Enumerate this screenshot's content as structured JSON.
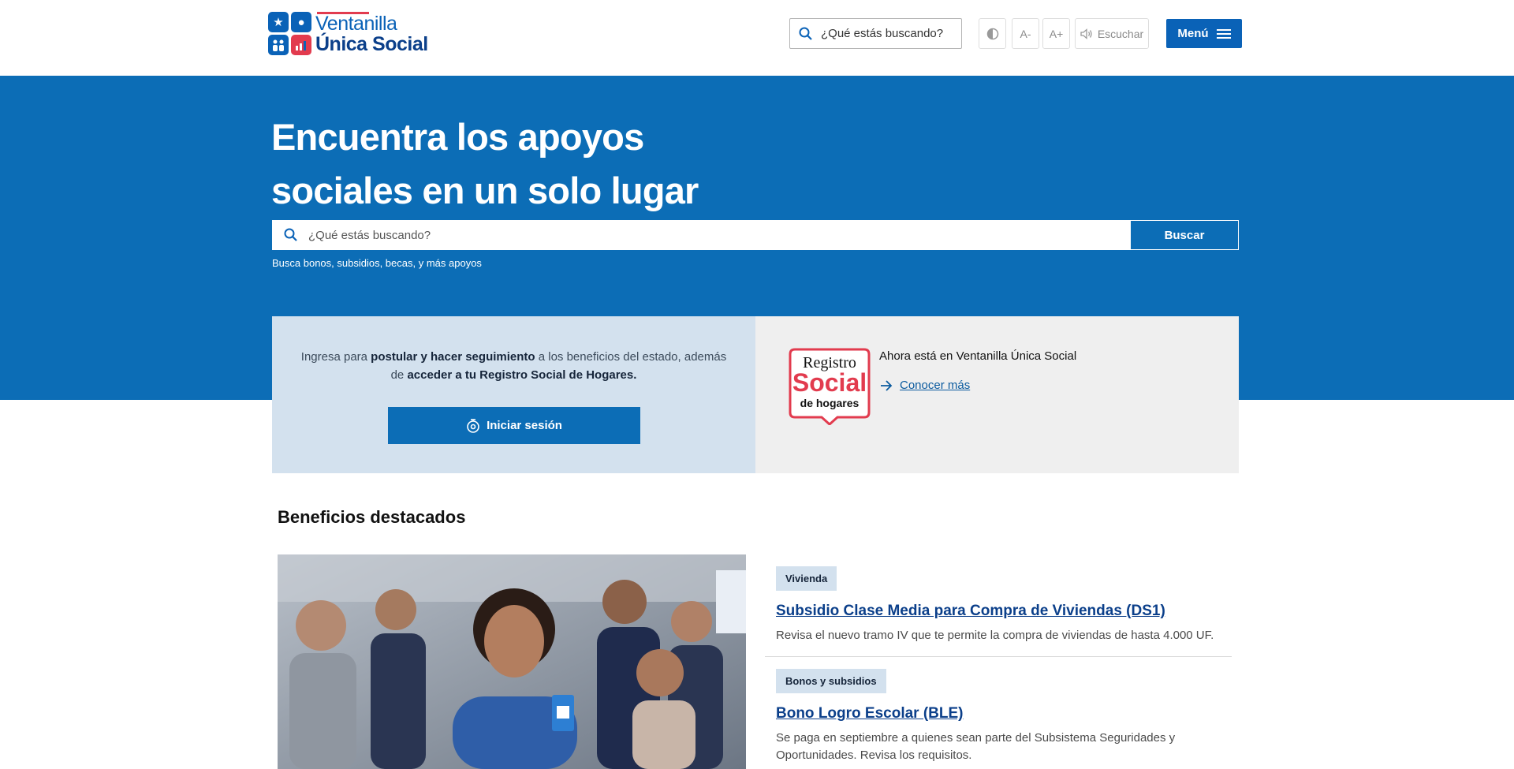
{
  "header": {
    "logo_line1": "Ventanilla",
    "logo_line2": "Única Social",
    "search_placeholder": "¿Qué estás buscando?",
    "contrast_icon": "contrast-icon",
    "font_decrease": "A-",
    "font_increase": "A+",
    "listen_label": "Escuchar",
    "menu_label": "Menú"
  },
  "hero": {
    "title_line1": "Encuentra los apoyos",
    "title_line2": "sociales en un solo lugar",
    "search_placeholder": "¿Qué estás buscando?",
    "search_button": "Buscar",
    "hint": "Busca bonos, subsidios, becas, y más apoyos"
  },
  "login_card": {
    "text_part1": "Ingresa para ",
    "text_bold1": "postular y hacer seguimiento",
    "text_part2": " a los beneficios del estado, además de ",
    "text_bold2": "acceder a tu Registro Social de Hogares.",
    "button_label": "Iniciar sesión"
  },
  "rsh_card": {
    "logo_line1": "Registro",
    "logo_line2": "Social",
    "logo_line3": "de hogares",
    "title": "Ahora está en Ventanilla Única Social",
    "link_label": "Conocer más"
  },
  "benefits": {
    "section_title": "Beneficios destacados",
    "items": [
      {
        "tag": "Vivienda",
        "title": "Subsidio Clase Media para Compra de Viviendas (DS1)",
        "description": "Revisa el nuevo tramo IV que te permite la compra de viviendas de hasta 4.000 UF."
      },
      {
        "tag": "Bonos y subsidios",
        "title": "Bono Logro Escolar (BLE)",
        "description": "Se paga en septiembre a quienes sean parte del Subsistema Seguridades y Oportunidades. Revisa los requisitos."
      }
    ]
  },
  "colors": {
    "primary": "#0c6db6",
    "navy": "#0b3f8a",
    "accent_red": "#e23b4e",
    "light_blue_bg": "#d3e1ee",
    "light_gray_bg": "#efefef"
  }
}
